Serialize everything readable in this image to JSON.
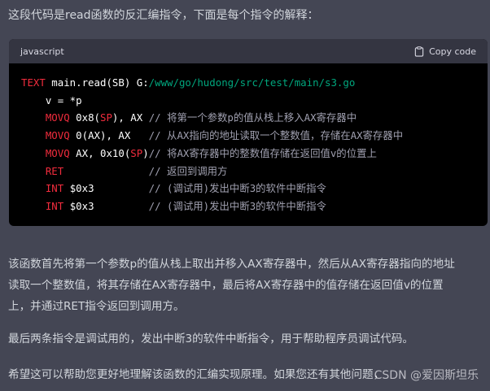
{
  "intro": "这段代码是read函数的反汇编指令，下面是每个指令的解释：",
  "code": {
    "language": "javascript",
    "copy_label": "Copy code",
    "line1": {
      "kw": "TEXT",
      "rest": " main.read(SB) G:",
      "path": "/www/go/hudong/src/test/main/s3.go"
    },
    "line2": "    v = *p",
    "line3": {
      "indent": "    ",
      "op": "MOVQ",
      "a": " 0x8(",
      "b": "SP",
      "c": "), AX ",
      "comment": "// 将第一个参数p的值从栈上移入AX寄存器中"
    },
    "line4": {
      "indent": "    ",
      "op": "MOVQ",
      "a": " 0(AX), AX   ",
      "comment": "// 从AX指向的地址读取一个整数值，存储在AX寄存器中"
    },
    "line5": {
      "indent": "    ",
      "op": "MOVQ",
      "a": " AX, 0x10(",
      "b": "SP",
      "c": ")",
      "comment": "// 将AX寄存器中的整数值存储在返回值v的位置上"
    },
    "line6": {
      "indent": "    ",
      "op": "RET",
      "pad": "              ",
      "comment": "// 返回到调用方"
    },
    "line7": {
      "indent": "    ",
      "op": "INT",
      "a": " $0x3         ",
      "comment": "// (调试用)发出中断3的软件中断指令"
    },
    "line8": {
      "indent": "    ",
      "op": "INT",
      "a": " $0x3         ",
      "comment": "// (调试用)发出中断3的软件中断指令"
    }
  },
  "para1_line1": "该函数首先将第一个参数p的值从栈上取出并移入AX寄存器中，然后从AX寄存器指向的地址",
  "para1_line2": "读取一个整数值，将其存储在AX寄存器中，最后将AX寄存器中的值存储在返回值v的位置",
  "para1_line3": "上，并通过RET指令返回到调用方。",
  "para2": "最后两条指令是调试用的，发出中断3的软件中断指令，用于帮助程序员调试代码。",
  "para3": "希望这可以帮助您更好地理解该函数的汇编实现原理。如果您还有其他问题，",
  "watermark": "CSDN @爱因斯坦乐"
}
